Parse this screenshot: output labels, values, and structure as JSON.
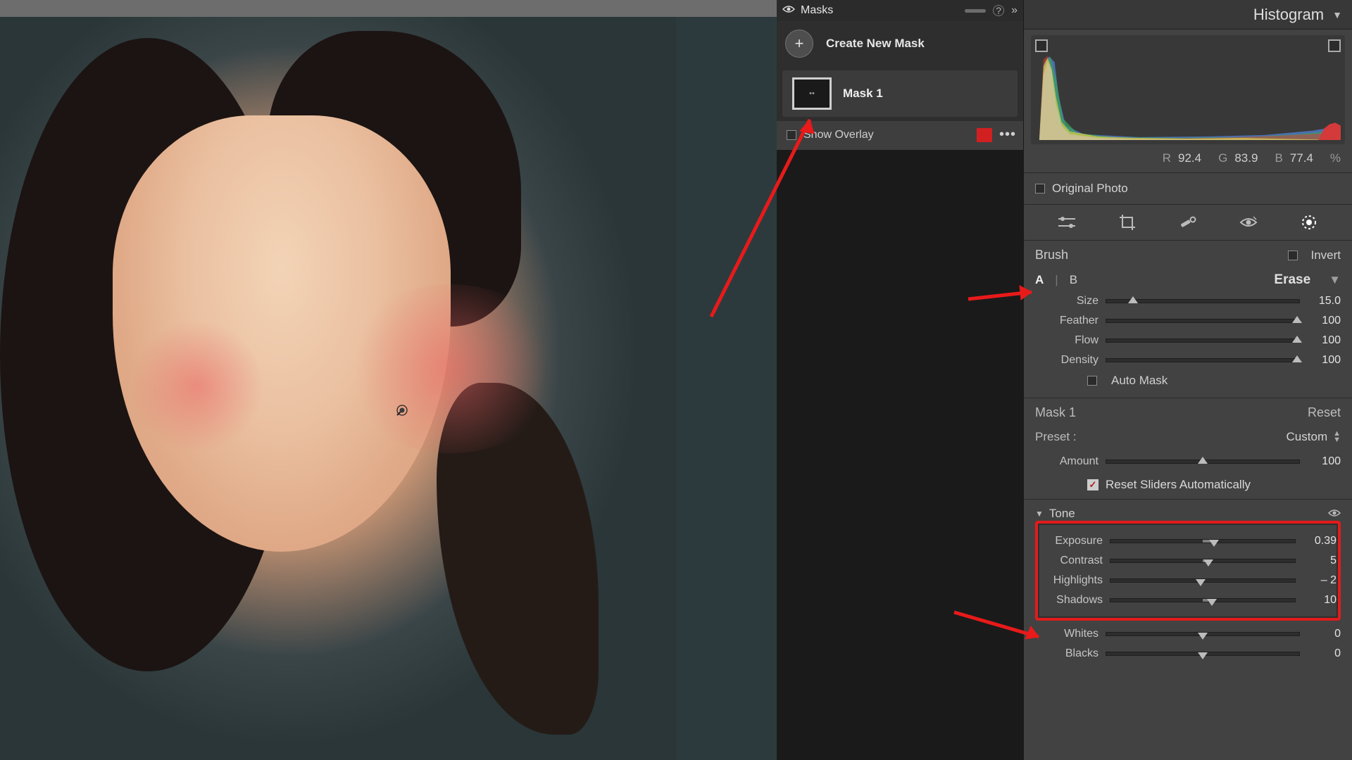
{
  "masks": {
    "title": "Masks",
    "create_label": "Create New Mask",
    "mask1_label": "Mask 1",
    "show_overlay_label": "Show Overlay",
    "swatch_color": "#d22020"
  },
  "histogram": {
    "title": "Histogram",
    "readout": {
      "r_label": "R",
      "r": "92.4",
      "g_label": "G",
      "g": "83.9",
      "b_label": "B",
      "b": "77.4",
      "pct": "%"
    },
    "original_label": "Original Photo"
  },
  "brush": {
    "title": "Brush",
    "invert_label": "Invert",
    "a": "A",
    "b": "B",
    "erase": "Erase",
    "size": {
      "label": "Size",
      "value": "15.0",
      "pos": 14
    },
    "feather": {
      "label": "Feather",
      "value": "100",
      "pos": 100
    },
    "flow": {
      "label": "Flow",
      "value": "100",
      "pos": 100
    },
    "density": {
      "label": "Density",
      "value": "100",
      "pos": 100
    },
    "automask": "Auto Mask"
  },
  "mask1_panel": {
    "title": "Mask 1",
    "reset": "Reset",
    "preset_label": "Preset :",
    "preset_value": "Custom",
    "amount": {
      "label": "Amount",
      "value": "100",
      "pos": 50
    },
    "reset_auto": "Reset Sliders Automatically"
  },
  "tone": {
    "title": "Tone",
    "exposure": {
      "label": "Exposure",
      "value": "0.39",
      "pos": 56
    },
    "contrast": {
      "label": "Contrast",
      "value": "5",
      "pos": 53
    },
    "highlights": {
      "label": "Highlights",
      "value": "– 2",
      "pos": 49
    },
    "shadows": {
      "label": "Shadows",
      "value": "10",
      "pos": 55
    },
    "whites": {
      "label": "Whites",
      "value": "0",
      "pos": 50
    },
    "blacks": {
      "label": "Blacks",
      "value": "0",
      "pos": 50
    }
  }
}
